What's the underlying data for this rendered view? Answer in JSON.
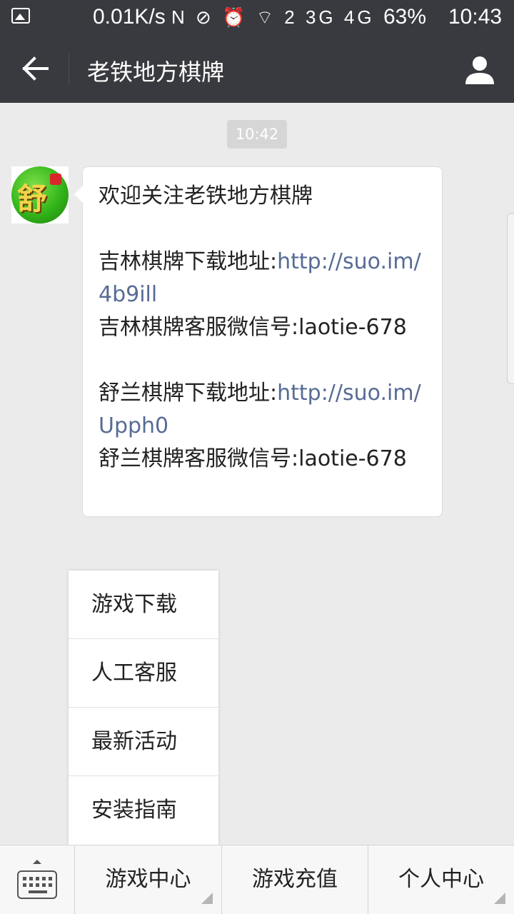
{
  "status_bar": {
    "speed": "0.01K/s",
    "icons": "N ⊘ ⏰ ⌔ 2 3G 4G",
    "battery": "63%",
    "time": "10:43"
  },
  "header": {
    "title": "老铁地方棋牌"
  },
  "chat": {
    "timestamp": "10:42",
    "message": {
      "greeting": "欢迎关注老铁地方棋牌",
      "jilin_download_label": "吉林棋牌下载地址:",
      "jilin_download_link": "http://suo.im/4b9ill",
      "jilin_service": "吉林棋牌客服微信号:laotie-678",
      "shulan_download_label": "舒兰棋牌下载地址:",
      "shulan_download_link": "http://suo.im/Upph0",
      "shulan_service": "舒兰棋牌客服微信号:laotie-678"
    }
  },
  "popup_menu": {
    "items": [
      {
        "label": "游戏下载"
      },
      {
        "label": "人工客服"
      },
      {
        "label": "最新活动"
      },
      {
        "label": "安装指南"
      }
    ]
  },
  "bottom_menu": {
    "items": [
      {
        "label": "游戏中心"
      },
      {
        "label": "游戏充值"
      },
      {
        "label": "个人中心"
      }
    ]
  },
  "colors": {
    "title_bar": "#393a3f",
    "background": "#ebebeb",
    "link": "#576b95"
  }
}
